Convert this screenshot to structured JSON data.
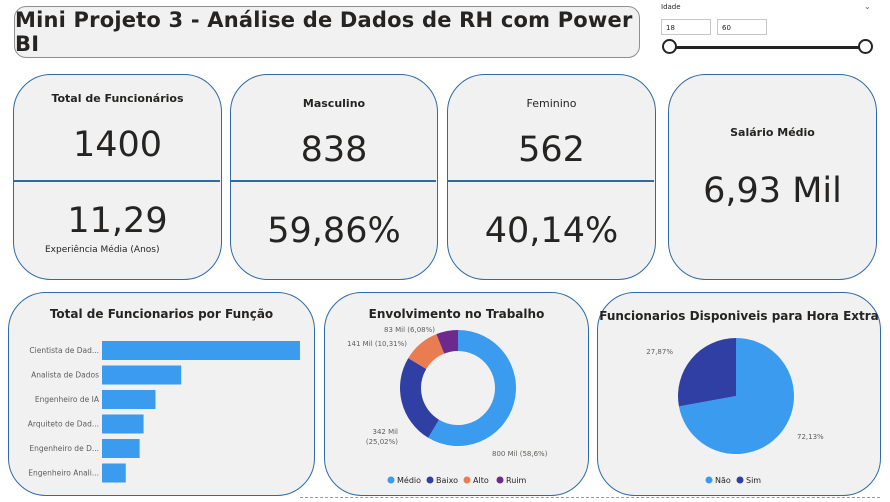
{
  "title": "Mini Projeto 3 - Análise de Dados de RH com Power BI",
  "slicer": {
    "label": "Idade",
    "min_value": "18",
    "max_value": "60",
    "range": [
      18,
      60
    ]
  },
  "kpi": {
    "total": {
      "label": "Total de Funcionários",
      "value": "1400",
      "exp_value": "11,29",
      "exp_label": "Experiência Média (Anos)"
    },
    "masc": {
      "label": "Masculino",
      "value": "838",
      "pct": "59,86%"
    },
    "fem": {
      "label": "Feminino",
      "value": "562",
      "pct": "40,14%"
    },
    "salario": {
      "label": "Salário Médio",
      "value": "6,93 Mil"
    }
  },
  "colors": {
    "accent": "#118dff",
    "blue": "#3a9bef",
    "dark_blue": "#2f3fa3",
    "orange": "#e97c51",
    "purple": "#6c2a8c",
    "border": "#2e6aa5"
  },
  "chart_data": [
    {
      "type": "bar",
      "title": "Total de Funcionarios por Função",
      "categories": [
        "Cientista de Dad...",
        "Analista de Dados",
        "Engenheiro de IA",
        "Arquiteto de Dad...",
        "Engenheiro de D...",
        "Engenheiro Anali..."
      ],
      "values": [
        100,
        40,
        27,
        21,
        19,
        12
      ],
      "orientation": "horizontal",
      "color": "#3a9bef"
    },
    {
      "type": "pie",
      "donut": true,
      "title": "Envolvimento no Trabalho",
      "categories": [
        "Médio",
        "Baixo",
        "Alto",
        "Ruim"
      ],
      "values": [
        58.6,
        25.02,
        10.31,
        6.08
      ],
      "colors": [
        "#3a9bef",
        "#2f3fa3",
        "#e97c51",
        "#6c2a8c"
      ],
      "data_labels": [
        "800 Mil (58,6%)",
        "342 Mil (25,02%)",
        "141 Mil (10,31%)",
        "83 Mil (6,08%)"
      ],
      "legend": "bottom"
    },
    {
      "type": "pie",
      "title": "Funcionarios Disponiveis para Hora Extra",
      "categories": [
        "Não",
        "Sim"
      ],
      "values": [
        72.13,
        27.87
      ],
      "colors": [
        "#3a9bef",
        "#2f3fa3"
      ],
      "data_labels": [
        "72,13%",
        "27,87%"
      ],
      "legend": "bottom"
    }
  ]
}
